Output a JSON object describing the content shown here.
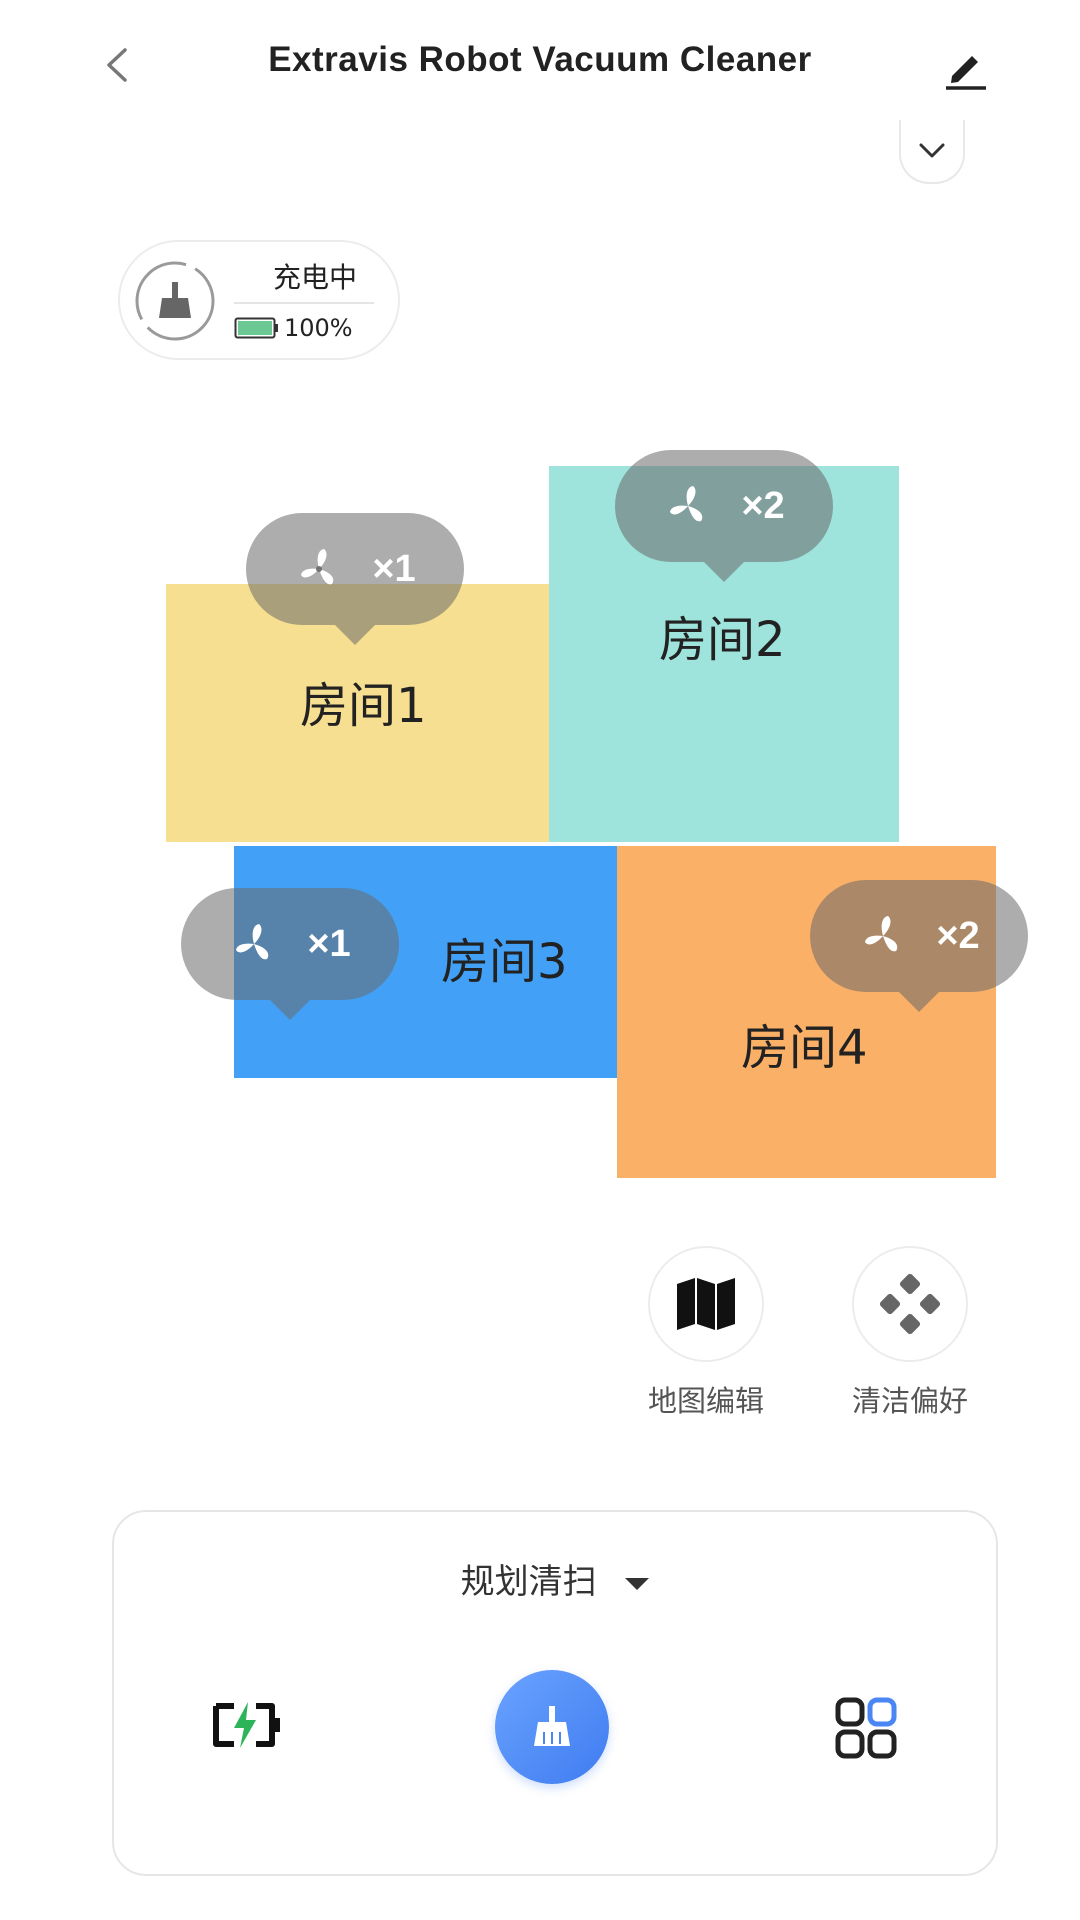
{
  "header": {
    "title": "Extravis Robot Vacuum Cleaner"
  },
  "status": {
    "state": "充电中",
    "battery": "100%",
    "battery_color": "#6cc893"
  },
  "rooms": [
    {
      "label": "房间1",
      "color": "#f6df90",
      "badge": "×1"
    },
    {
      "label": "房间2",
      "color": "#9ee3dc",
      "badge": "×2"
    },
    {
      "label": "房间3",
      "color": "#42a0f7",
      "badge": "×1"
    },
    {
      "label": "房间4",
      "color": "#fbb067",
      "badge": "×2"
    }
  ],
  "tools": {
    "map_edit": "地图编辑",
    "clean_pref": "清洁偏好"
  },
  "bottom": {
    "mode": "规划清扫",
    "accent": "#4a86f4"
  }
}
